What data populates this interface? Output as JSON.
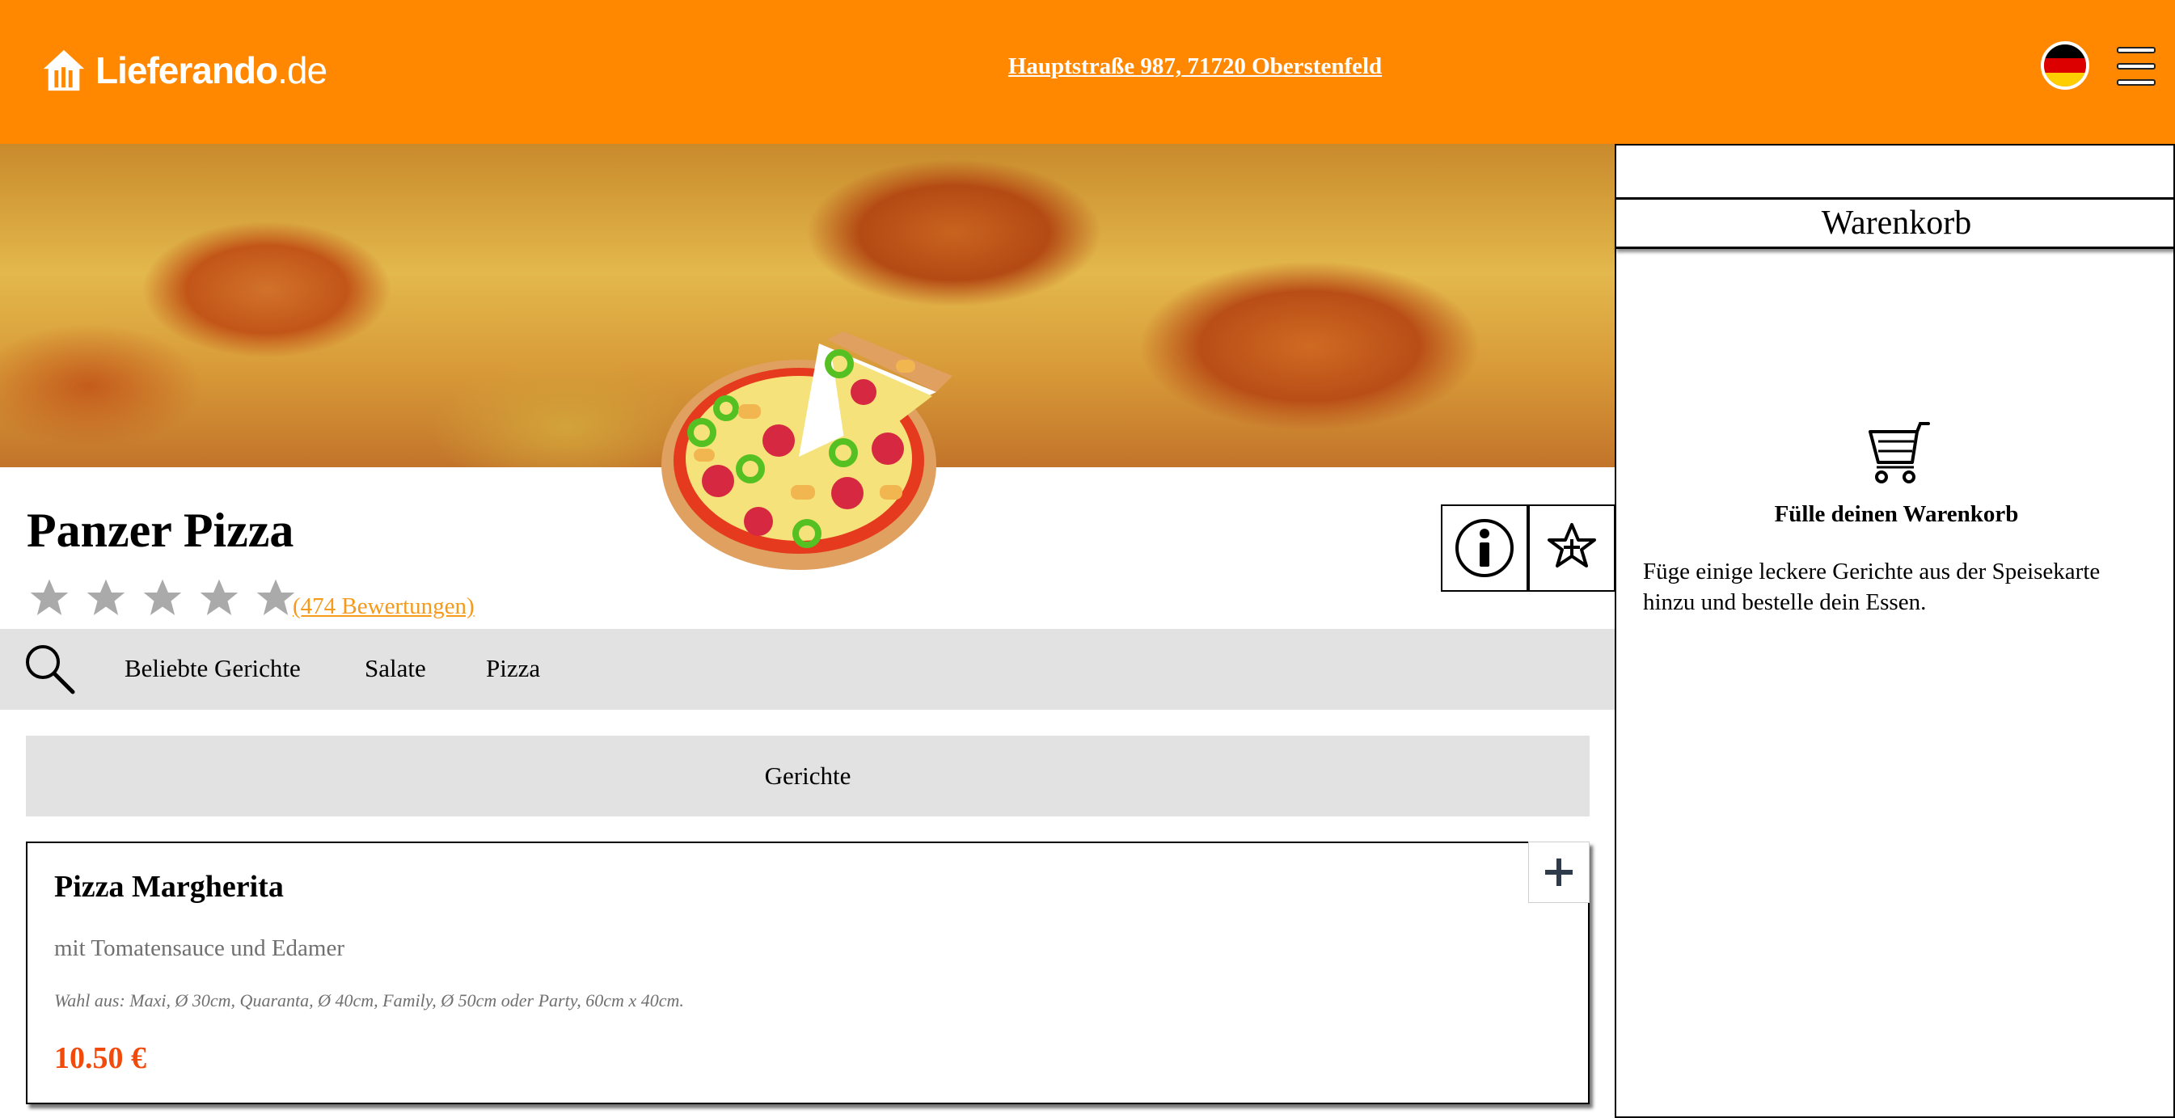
{
  "header": {
    "logo_brand": "Lieferando",
    "logo_tld": ".de",
    "address": "Hauptstraße 987, 71720 Oberstenfeld",
    "language_icon": "germany-flag-icon",
    "menu_icon": "hamburger-menu-icon",
    "colors": {
      "bar": "#ff8800"
    }
  },
  "restaurant": {
    "name": "Panzer Pizza",
    "rating_stars": 0,
    "rating_max": 5,
    "reviews_text": "(474 Bewertungen)",
    "info_icon": "info-icon",
    "favorite_icon": "star-plus-icon"
  },
  "categories": {
    "search_icon": "search-icon",
    "items": [
      "Beliebte Gerichte",
      "Salate",
      "Pizza"
    ]
  },
  "menu": {
    "section_title": "Gerichte",
    "dishes": [
      {
        "name": "Pizza Margherita",
        "description": "mit Tomatensauce und Edamer",
        "options": "Wahl aus: Maxi, Ø 30cm, Quaranta, Ø 40cm, Family, Ø 50cm oder Party, 60cm x 40cm.",
        "price": "10.50 €",
        "add_icon": "plus-icon"
      }
    ]
  },
  "cart": {
    "title": "Warenkorb",
    "empty_icon": "shopping-cart-icon",
    "empty_title": "Fülle deinen Warenkorb",
    "empty_text": "Füge einige leckere Gerichte aus der Speisekarte hinzu und bestelle dein Essen."
  }
}
